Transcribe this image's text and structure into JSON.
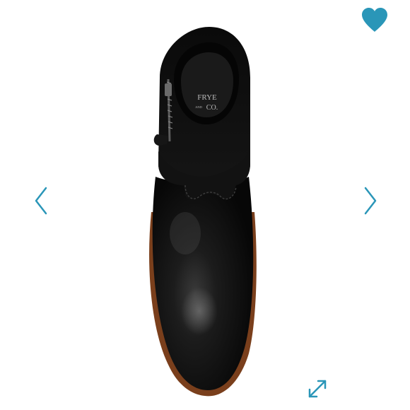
{
  "product_image": {
    "brand_line_1": "FRYE",
    "brand_and": "AND",
    "brand_line_2": "CO."
  },
  "controls": {
    "favorite_icon": "heart-icon",
    "previous_icon": "chevron-left-icon",
    "next_icon": "chevron-right-icon",
    "expand_icon": "expand-arrows-icon"
  },
  "colors": {
    "accent": "#2a96b8",
    "boot_leather": "#0d0d0d",
    "sole_edge": "#8a4a22"
  }
}
